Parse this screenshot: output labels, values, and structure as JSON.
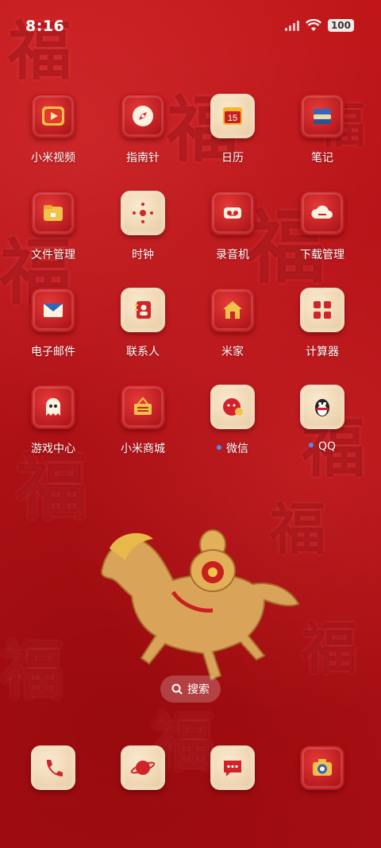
{
  "status": {
    "time": "8:16",
    "battery": "100"
  },
  "apps": [
    {
      "label": "小米视频",
      "icon": "video-play-icon",
      "style": "red",
      "dot": false
    },
    {
      "label": "指南针",
      "icon": "compass-icon",
      "style": "red",
      "dot": false
    },
    {
      "label": "日历",
      "icon": "calendar-icon",
      "style": "cream",
      "dot": false,
      "date": "15"
    },
    {
      "label": "笔记",
      "icon": "notes-icon",
      "style": "red",
      "dot": false
    },
    {
      "label": "文件管理",
      "icon": "folder-icon",
      "style": "red",
      "dot": false
    },
    {
      "label": "时钟",
      "icon": "clock-icon",
      "style": "cream",
      "dot": false
    },
    {
      "label": "录音机",
      "icon": "recorder-icon",
      "style": "red",
      "dot": false
    },
    {
      "label": "下载管理",
      "icon": "download-cloud-icon",
      "style": "red",
      "dot": false
    },
    {
      "label": "电子邮件",
      "icon": "mail-icon",
      "style": "red",
      "dot": false
    },
    {
      "label": "联系人",
      "icon": "contacts-icon",
      "style": "cream",
      "dot": false
    },
    {
      "label": "米家",
      "icon": "home-icon",
      "style": "red",
      "dot": false
    },
    {
      "label": "计算器",
      "icon": "calculator-icon",
      "style": "cream",
      "dot": false
    },
    {
      "label": "游戏中心",
      "icon": "ghost-icon",
      "style": "red",
      "dot": false
    },
    {
      "label": "小米商城",
      "icon": "shopping-basket-icon",
      "style": "red",
      "dot": false
    },
    {
      "label": "微信",
      "icon": "wechat-icon",
      "style": "cream",
      "dot": true
    },
    {
      "label": "QQ",
      "icon": "qq-penguin-icon",
      "style": "cream",
      "dot": true
    }
  ],
  "search": {
    "label": "搜索",
    "icon": "search-icon"
  },
  "dock": [
    {
      "icon": "phone-icon",
      "style": "cream"
    },
    {
      "icon": "browser-planet-icon",
      "style": "cream"
    },
    {
      "icon": "messages-icon",
      "style": "cream"
    },
    {
      "icon": "camera-icon",
      "style": "red"
    }
  ],
  "colors": {
    "wallpaper": "#b41318",
    "accent_gold": "#e8b84a",
    "dot_blue": "#4f8cff"
  }
}
